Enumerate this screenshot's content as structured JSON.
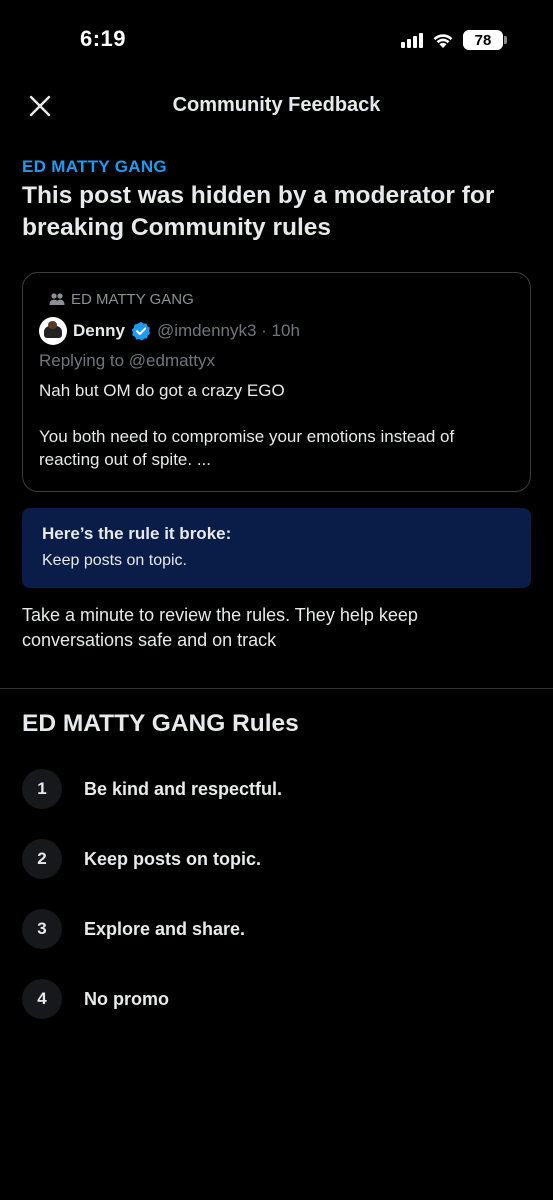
{
  "status_bar": {
    "time": "6:19",
    "battery": "78"
  },
  "header": {
    "title": "Community Feedback"
  },
  "notice": {
    "community_name": "ED MATTY GANG",
    "heading": "This post was hidden by a moderator for breaking Community rules"
  },
  "post": {
    "community_label": "ED MATTY GANG",
    "author_name": "Denny",
    "author_handle": "@imdennyk3 · 10h",
    "replying_to": "Replying to @edmattyx",
    "text_line_1": "Nah but OM do got a crazy EGO",
    "text_line_2": "You both need to compromise your emotions instead of reacting out of spite. ..."
  },
  "rule_broken": {
    "title": "Here’s the rule it broke:",
    "rule": "Keep posts on topic."
  },
  "review_text": "Take a minute to review the rules. They help keep conversations safe and on track",
  "rules": {
    "heading": "ED MATTY GANG Rules",
    "items": [
      {
        "number": "1",
        "label": "Be kind and respectful."
      },
      {
        "number": "2",
        "label": "Keep posts on topic."
      },
      {
        "number": "3",
        "label": "Explore and share."
      },
      {
        "number": "4",
        "label": "No promo"
      }
    ]
  },
  "colors": {
    "accent": "#1d9bf0",
    "rule_box_bg": "#0a1c48",
    "background": "#000000"
  },
  "icons": {
    "close": "close-icon",
    "community": "people-icon",
    "verified": "verified-badge-icon"
  }
}
